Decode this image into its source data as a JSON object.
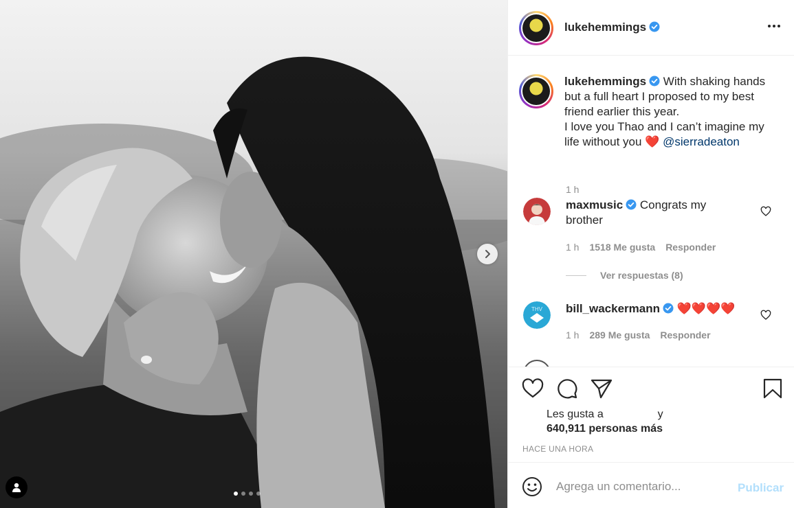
{
  "post": {
    "username": "lukehemmings",
    "verified": true,
    "caption_lines": [
      "With shaking hands",
      "but a full heart I proposed to my best",
      "friend earlier this year.",
      "I love you Thao and I can’t imagine my",
      "life without you"
    ],
    "caption_emoji": "❤️",
    "caption_mention": "@sierradeaton",
    "caption_time": "1 h"
  },
  "comments": [
    {
      "username": "maxmusic",
      "verified": true,
      "text_line1": "Congrats my",
      "text_line2": "brother",
      "time": "1 h",
      "likes": "1518 Me gusta",
      "reply_label": "Responder"
    },
    {
      "username": "bill_wackermann",
      "verified": true,
      "text": "❤️❤️❤️❤️",
      "time": "1 h",
      "likes": "289 Me gusta",
      "reply_label": "Responder"
    }
  ],
  "replies_label": "Ver respuestas (8)",
  "likes": {
    "prefix": "Les gusta a",
    "conjunction": "y",
    "count_text": "640,911 personas más"
  },
  "posted_ago": "HACE UNA HORA",
  "comment_box": {
    "placeholder": "Agrega un comentario...",
    "publish_label": "Publicar"
  },
  "carousel": {
    "total_slides": 4,
    "active_index": 0
  },
  "icons": {
    "header_more": "more-horizontal-icon",
    "like": "heart-outline-icon",
    "comment": "comment-bubble-icon",
    "share": "paper-plane-icon",
    "save": "bookmark-icon",
    "emoji": "smiley-icon",
    "next": "chevron-right-icon",
    "tag": "user-tag-icon"
  },
  "colors": {
    "verified_blue": "#3897f0",
    "heart_red": "#e0242f",
    "mention": "#00376b",
    "publish_disabled": "#b2dffc",
    "secondary_text": "#8e8e8e"
  }
}
